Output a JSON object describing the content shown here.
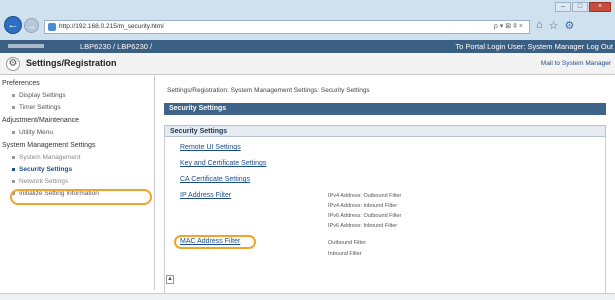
{
  "browser": {
    "url": "http://192.168.0.215/m_security.html",
    "address_tools": "ρ ▾ ⊠ ¢ ×",
    "icons": [
      "home-icon",
      "star-icon",
      "gear-icon"
    ]
  },
  "product_bar": {
    "name": "LBP6230 / LBP6230 /",
    "right_text": "To Portal  Login User: System Manager Log Out"
  },
  "page_header": {
    "title": "Settings/Registration",
    "mail_link": "Mail to System Manager"
  },
  "sidebar": {
    "groups": [
      {
        "label": "Preferences",
        "items": [
          "Display Settings",
          "Timer Settings"
        ]
      },
      {
        "label": "Adjustment/Maintenance",
        "items": [
          "Utility Menu"
        ]
      },
      {
        "label": "System Management Settings",
        "items": [
          "System Management",
          "Security Settings",
          "Network Settings",
          "Initialize Setting Information"
        ]
      }
    ],
    "active_item": "Security Settings"
  },
  "main": {
    "breadcrumb": "Settings/Registration: System Management Settings: Security Settings",
    "section_title": "Security Settings",
    "subsection_title": "Security Settings",
    "links": [
      "Remote UI Settings",
      "Key and Certificate Settings",
      "CA Certificate Settings",
      "IP Address Filter",
      "MAC Address Filter"
    ],
    "ip_filter_desc": [
      "IPv4 Address: Outbound Filter",
      "IPv4 Address: Inbound Filter",
      "IPv6 Address: Outbound Filter",
      "IPv6 Address: Inbound Filter"
    ],
    "mac_filter_desc": [
      "Outbound Filter",
      "Inbound Filter"
    ]
  },
  "colors": {
    "highlight_oval": "#f0a52a",
    "product_bar": "#3b5e83",
    "section_bar": "#3f6389",
    "link": "#1b4d8c"
  }
}
